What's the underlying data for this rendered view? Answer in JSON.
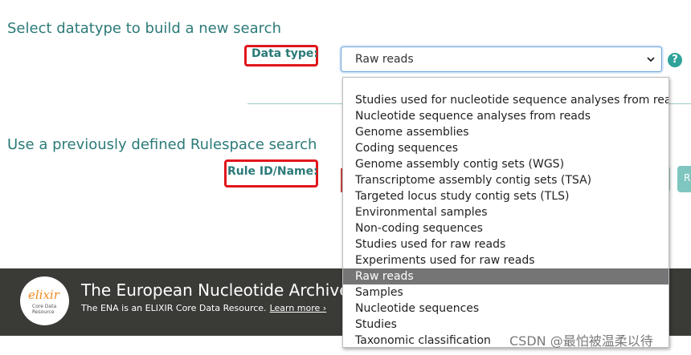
{
  "new_search": {
    "title": "Select datatype to build a new search",
    "datatype_label": "Data type:",
    "selected_value": "Raw reads",
    "help_icon_glyph": "?"
  },
  "previous_search": {
    "title": "Use a previously defined Rulespace search",
    "rule_label": "Rule ID/Name:"
  },
  "dropdown_options": [
    "Studies used for nucleotide sequence analyses from reads",
    "Nucleotide sequence analyses from reads",
    "Genome assemblies",
    "Coding sequences",
    "Genome assembly contig sets (WGS)",
    "Transcriptome assembly contig sets (TSA)",
    "Targeted locus study contig sets (TLS)",
    "Environmental samples",
    "Non-coding sequences",
    "Studies used for raw reads",
    "Experiments used for raw reads",
    "Raw reads",
    "Samples",
    "Nucleotide sequences",
    "Studies",
    "Taxonomic classification"
  ],
  "footer": {
    "title": "The European Nucleotide Archive (",
    "subtitle": "The ENA is an ELIXIR Core Data Resource.",
    "learn_more": "Learn more ›",
    "logo_word": "elixir",
    "logo_sub": "Core Data Resource"
  },
  "colors": {
    "accent_teal": "#2b7a78",
    "highlight_red": "#e0161c",
    "footer_bg": "#3a3a37",
    "selected_option_bg": "#757575"
  },
  "watermark": "CSDN @最怕被温柔以待"
}
